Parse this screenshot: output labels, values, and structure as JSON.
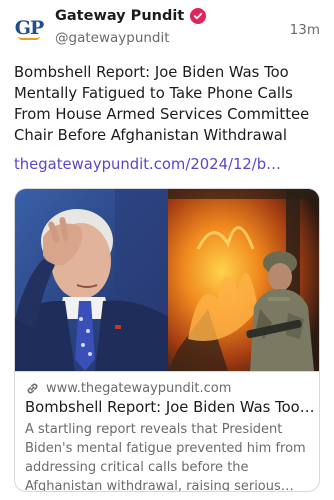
{
  "account": {
    "display_name": "Gateway Pundit",
    "handle": "@gatewaypundit",
    "avatar_text": "GP",
    "verified": true,
    "verified_color": "#e0245e",
    "brand_color": "#1f4e8c"
  },
  "post": {
    "timestamp": "13m",
    "text": "Bombshell Report: Joe Biden Was Too Mentally Fatigued to Take Phone Calls From House Armed Services Committee Chair Before Afghanistan Withdrawal",
    "link_text": "thegatewaypundit.com/2024/12/b…",
    "link_color": "#5b46c8"
  },
  "card": {
    "domain": "www.thegatewaypundit.com",
    "title": "Bombshell Report: Joe Biden Was Too Mentally Fatigued to Take Phone Calls From House Armed Services Committee Chair Before Afghanistan Withdrawal",
    "description": "A startling report reveals that President Biden's mental fatigue prevented him from addressing critical calls before the Afghanistan withdrawal, raising serious questions",
    "link_icon": "link-icon",
    "image_left": "man-in-suit-hand-on-face",
    "image_right": "soldier-in-front-of-fire"
  }
}
